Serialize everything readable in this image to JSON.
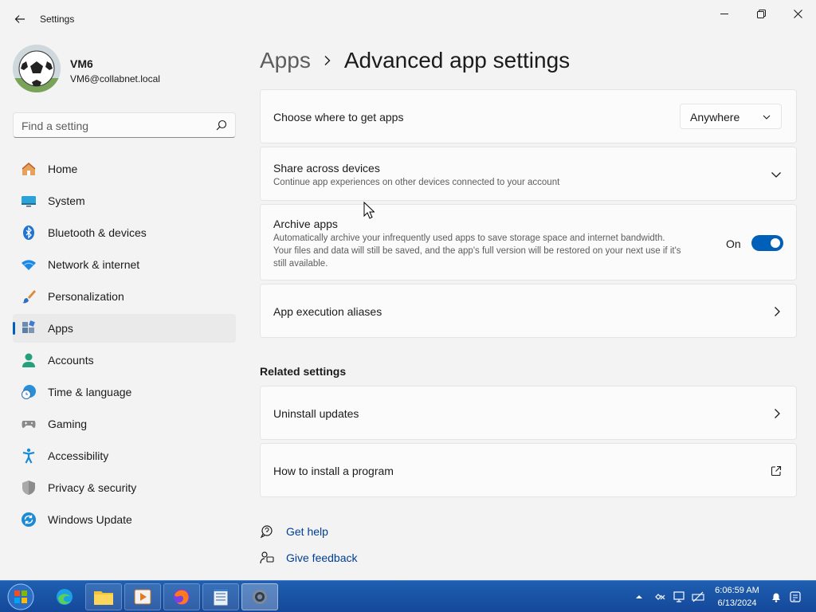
{
  "window": {
    "title": "Settings",
    "back_icon": "back-arrow-icon",
    "controls": [
      "minimize-icon",
      "restore-icon",
      "close-icon"
    ]
  },
  "profile": {
    "name": "VM6",
    "email": "VM6@collabnet.local",
    "avatar_icon": "soccer-ball-avatar"
  },
  "search": {
    "placeholder": "Find a setting",
    "value": "",
    "icon": "search-icon"
  },
  "sidebar": {
    "active": "Apps",
    "items": [
      {
        "label": "Home",
        "icon": "home-icon"
      },
      {
        "label": "System",
        "icon": "monitor-icon"
      },
      {
        "label": "Bluetooth & devices",
        "icon": "bluetooth-icon"
      },
      {
        "label": "Network & internet",
        "icon": "wifi-icon"
      },
      {
        "label": "Personalization",
        "icon": "paintbrush-icon"
      },
      {
        "label": "Apps",
        "icon": "apps-icon"
      },
      {
        "label": "Accounts",
        "icon": "person-icon"
      },
      {
        "label": "Time & language",
        "icon": "clock-globe-icon"
      },
      {
        "label": "Gaming",
        "icon": "gamepad-icon"
      },
      {
        "label": "Accessibility",
        "icon": "accessibility-icon"
      },
      {
        "label": "Privacy & security",
        "icon": "shield-icon"
      },
      {
        "label": "Windows Update",
        "icon": "update-icon"
      }
    ]
  },
  "breadcrumb": {
    "parent": "Apps",
    "current": "Advanced app settings"
  },
  "settings": {
    "choose_where": {
      "title": "Choose where to get apps",
      "dropdown_value": "Anywhere"
    },
    "share_devices": {
      "title": "Share across devices",
      "description": "Continue app experiences on other devices connected to your account"
    },
    "archive_apps": {
      "title": "Archive apps",
      "description_line1": "Automatically archive your infrequently used apps to save storage space and internet bandwidth.",
      "description_line2": "Your files and data will still be saved, and the app's full version will be restored on your next use if it's",
      "description_line3": "still available.",
      "toggle_label": "On",
      "toggle_on": true
    },
    "execution_aliases": {
      "title": "App execution aliases"
    }
  },
  "related": {
    "heading": "Related settings",
    "uninstall_updates": "Uninstall updates",
    "how_to_install": "How to install a program"
  },
  "help_links": {
    "get_help": "Get help",
    "give_feedback": "Give feedback"
  },
  "taskbar": {
    "start_icon": "windows-start-orb",
    "apps": [
      "edge-icon",
      "file-explorer-icon",
      "media-player-icon",
      "firefox-icon",
      "notepad-icon",
      "settings-gear-icon"
    ],
    "active_app": "settings-gear-icon",
    "tray": [
      "show-hidden-icons",
      "action-center-icon",
      "network-icon",
      "vpn-icon",
      "notification-bell-icon",
      "sound-icon"
    ],
    "time": "6:06:59 AM",
    "date": "6/13/2024"
  },
  "colors": {
    "accent": "#005fb8",
    "link": "#003e92",
    "background": "#f3f3f3",
    "card": "#fbfbfb",
    "taskbar": "#1a53a5"
  }
}
